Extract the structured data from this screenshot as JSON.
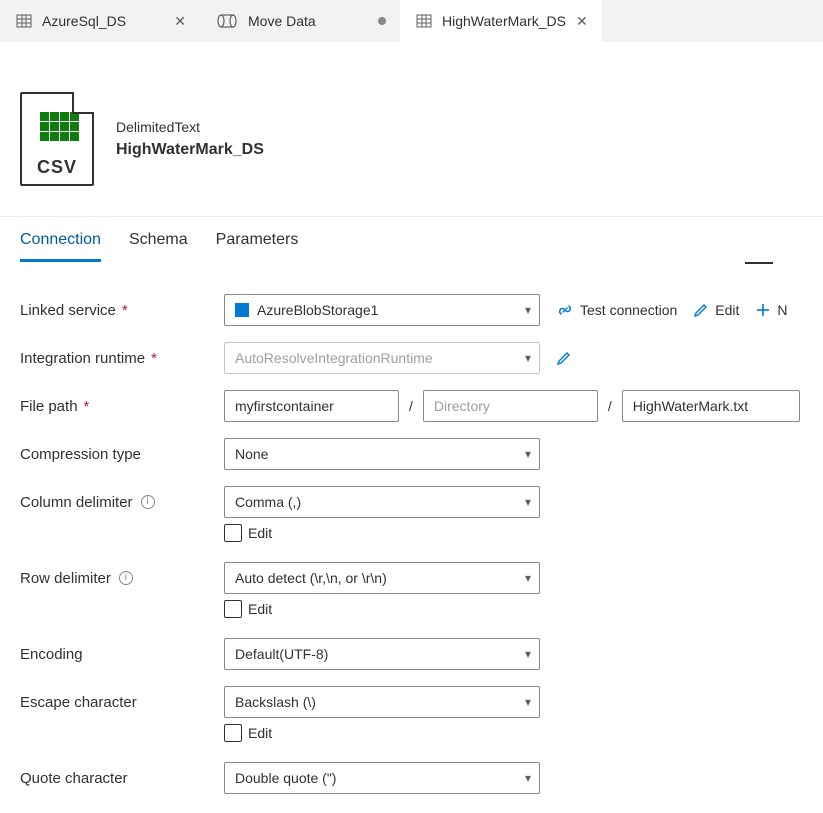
{
  "tabs": [
    {
      "label": "AzureSql_DS",
      "dirty": false,
      "closable": true,
      "active": false
    },
    {
      "label": "Move Data",
      "dirty": true,
      "closable": false,
      "active": false
    },
    {
      "label": "HighWaterMark_DS",
      "dirty": false,
      "closable": true,
      "active": true
    }
  ],
  "header": {
    "type_label": "DelimitedText",
    "name": "HighWaterMark_DS",
    "icon_text": "CSV"
  },
  "subtabs": {
    "connection": "Connection",
    "schema": "Schema",
    "parameters": "Parameters"
  },
  "labels": {
    "linked_service": "Linked service",
    "integration_runtime": "Integration runtime",
    "file_path": "File path",
    "compression_type": "Compression type",
    "column_delimiter": "Column delimiter",
    "row_delimiter": "Row delimiter",
    "encoding": "Encoding",
    "escape_character": "Escape character",
    "quote_character": "Quote character",
    "edit": "Edit"
  },
  "actions": {
    "test_connection": "Test connection",
    "edit": "Edit",
    "new_truncated": "N"
  },
  "values": {
    "linked_service": "AzureBlobStorage1",
    "integration_runtime": "AutoResolveIntegrationRuntime",
    "file_container": "myfirstcontainer",
    "file_directory_placeholder": "Directory",
    "file_name": "HighWaterMark.txt",
    "compression_type": "None",
    "column_delimiter": "Comma (,)",
    "row_delimiter": "Auto detect (\\r,\\n, or \\r\\n)",
    "encoding": "Default(UTF-8)",
    "escape_character": "Backslash (\\)",
    "quote_character": "Double quote (\")"
  },
  "path_separator": "/"
}
